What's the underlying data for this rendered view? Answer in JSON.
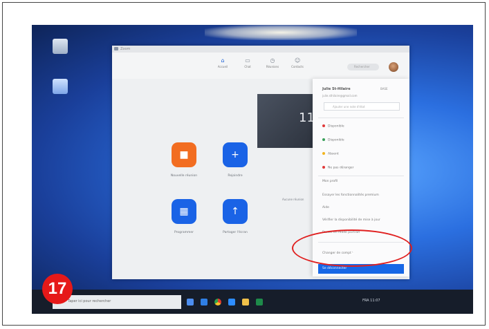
{
  "window": {
    "title": "Zoom"
  },
  "nav": {
    "items": [
      {
        "label": "Accueil",
        "icon": "home-icon"
      },
      {
        "label": "Chat",
        "icon": "chat-icon"
      },
      {
        "label": "Réunions",
        "icon": "clock-icon"
      },
      {
        "label": "Contacts",
        "icon": "contacts-icon"
      }
    ],
    "search_placeholder": "Rechercher"
  },
  "tiles": [
    {
      "label": "Nouvelle réunion",
      "icon": "video-camera-icon",
      "color": "#f26d21"
    },
    {
      "label": "Rejoindre",
      "icon": "plus-icon",
      "color": "#1a63e6"
    },
    {
      "label": "Programmer",
      "icon": "calendar-icon",
      "color": "#1a63e6"
    },
    {
      "label": "Partager l'écran",
      "icon": "share-screen-icon",
      "color": "#1a63e6"
    }
  ],
  "preview": {
    "time": "11"
  },
  "side_text": "Aucune réunion",
  "menu": {
    "name": "Julie St-Hilaire",
    "badge": "BASE",
    "email": "julie.sthilaire@gmail.com",
    "status_field_placeholder": "Ajouter une note d'état",
    "statuses": [
      {
        "label": "Disponible",
        "color": "#e03a3a"
      },
      {
        "label": "Disponible",
        "color": "#3aa05a"
      },
      {
        "label": "Absent",
        "color": "#f2b41e"
      },
      {
        "label": "Ne pas déranger",
        "color": "#e03a3a"
      }
    ],
    "items": [
      "Mon profil",
      "Essayer les fonctionnalités premium",
      "Aide",
      "Vérifier la disponibilité de mise à jour",
      "Passer en mode portrait",
      "Changer de compte"
    ],
    "selected_item": "Se déconnecter"
  },
  "taskbar": {
    "search_placeholder": "Taper ici pour rechercher",
    "tray_text": "FRA  11:07"
  },
  "step_number": "17",
  "colors": {
    "highlight": "#e02020",
    "accent": "#1767e6"
  }
}
